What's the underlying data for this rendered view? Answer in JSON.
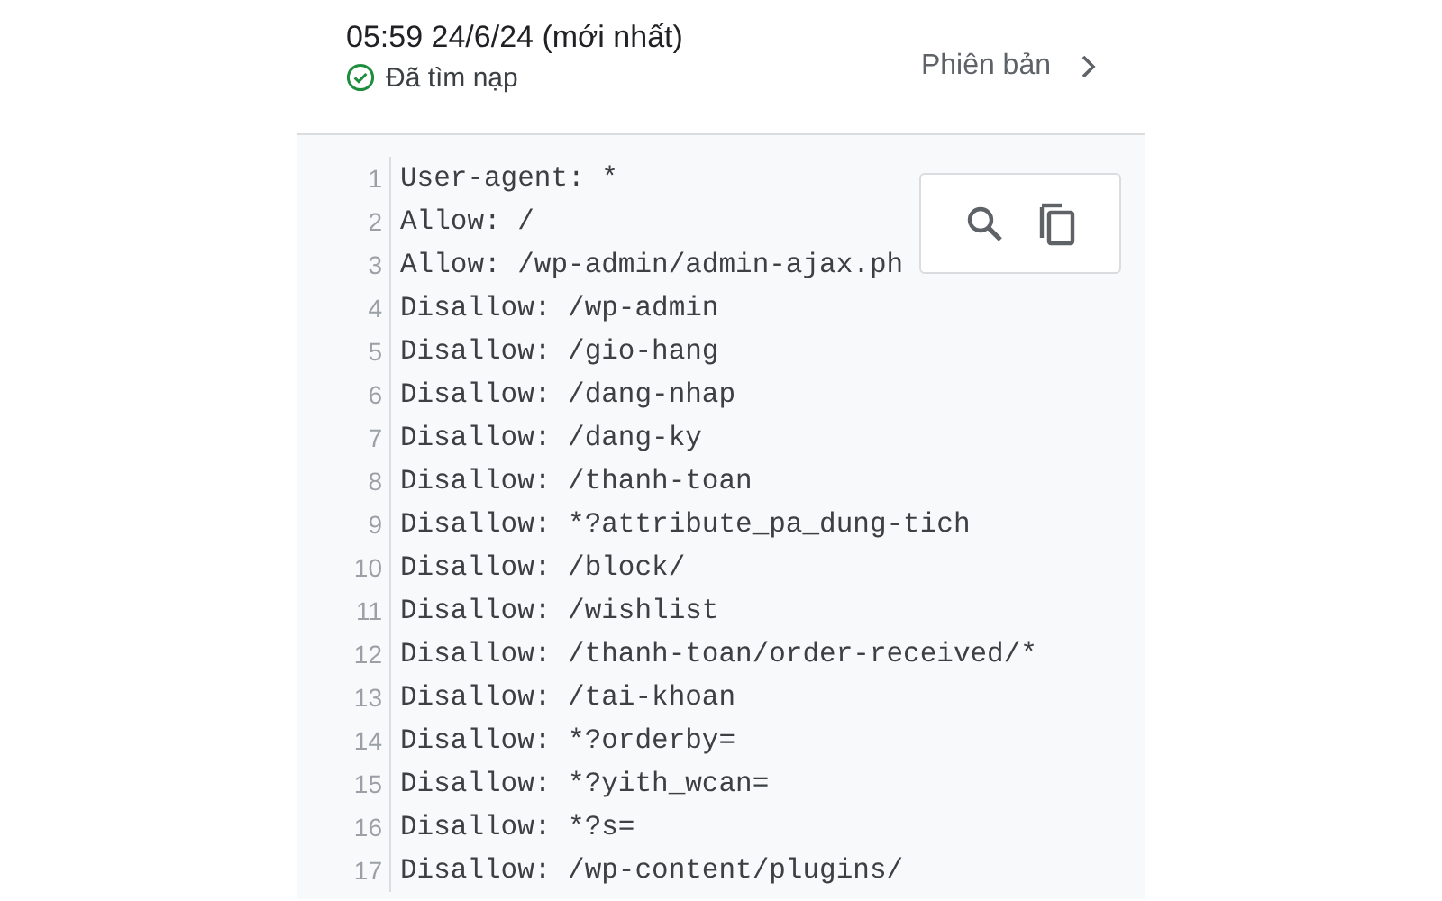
{
  "header": {
    "title": "05:59 24/6/24 (mới nhất)",
    "status": {
      "kind": "success",
      "text": "Đã tìm nạp"
    },
    "versions_link": "Phiên bản"
  },
  "code": {
    "lines": [
      {
        "number": "1",
        "text": "User-agent: *"
      },
      {
        "number": "2",
        "text": "Allow: /"
      },
      {
        "number": "3",
        "text": "Allow: /wp-admin/admin-ajax.ph"
      },
      {
        "number": "4",
        "text": "Disallow: /wp-admin"
      },
      {
        "number": "5",
        "text": "Disallow: /gio-hang"
      },
      {
        "number": "6",
        "text": "Disallow: /dang-nhap"
      },
      {
        "number": "7",
        "text": "Disallow: /dang-ky"
      },
      {
        "number": "8",
        "text": "Disallow: /thanh-toan"
      },
      {
        "number": "9",
        "text": "Disallow: *?attribute_pa_dung-tich"
      },
      {
        "number": "10",
        "text": "Disallow: /block/"
      },
      {
        "number": "11",
        "text": "Disallow: /wishlist"
      },
      {
        "number": "12",
        "text": "Disallow: /thanh-toan/order-received/*"
      },
      {
        "number": "13",
        "text": "Disallow: /tai-khoan"
      },
      {
        "number": "14",
        "text": "Disallow: *?orderby="
      },
      {
        "number": "15",
        "text": "Disallow: *?yith_wcan="
      },
      {
        "number": "16",
        "text": "Disallow: *?s="
      },
      {
        "number": "17",
        "text": "Disallow: /wp-content/plugins/"
      }
    ]
  }
}
